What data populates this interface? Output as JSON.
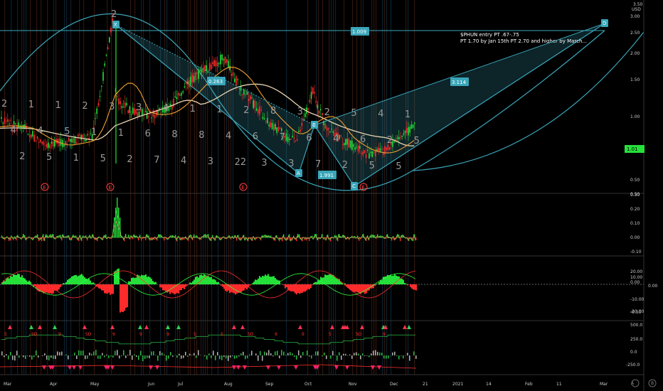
{
  "chart": {
    "currency": "USD",
    "annotation_lines": [
      "$PHUN entry PT .67-.75",
      "PT 1.70 by Jan 15th PT 2.70 and higher by March..."
    ],
    "last_price_label": "1.01",
    "colors": {
      "up": "#26e03a",
      "down": "#ff2b2b",
      "pattern": "#3aa6b9",
      "ma_tan": "#e8d4b0",
      "ma_orange": "#f0a030"
    }
  },
  "chart_data": [
    {
      "type": "candlestick",
      "panel": "price",
      "xlabels": [
        "Mar",
        "Apr",
        "May",
        "Jun",
        "Jul",
        "Aug",
        "Sep",
        "Oct",
        "Nov",
        "Dec",
        "21",
        "2021",
        "14",
        "Feb",
        "11",
        "Mar"
      ],
      "yticks": [
        0.5,
        1.0,
        1.5,
        2.0,
        2.5,
        3.0
      ],
      "ytick_labels": [
        "0.50",
        "1.00",
        "1.50",
        "2.00",
        "2.50",
        "3.00"
      ],
      "ylim": [
        0.5,
        3.5
      ],
      "top_label": "3.50",
      "bottom_label": "0.50",
      "price_path": [
        [
          "Mar",
          0.95
        ],
        [
          "Apr",
          0.85
        ],
        [
          "Apr",
          0.72
        ],
        [
          "May",
          0.75
        ],
        [
          "May",
          0.8
        ],
        [
          "May",
          3.0
        ],
        [
          "May",
          1.2
        ],
        [
          "Jun",
          1.05
        ],
        [
          "Jun",
          1.0
        ],
        [
          "Jul",
          1.1
        ],
        [
          "Jul",
          1.5
        ],
        [
          "Aug",
          1.9
        ],
        [
          "Aug",
          1.4
        ],
        [
          "Sep",
          1.1
        ],
        [
          "Sep",
          0.88
        ],
        [
          "Oct",
          0.75
        ],
        [
          "Oct",
          1.3
        ],
        [
          "Oct",
          0.85
        ],
        [
          "Nov",
          0.72
        ],
        [
          "Nov",
          0.65
        ],
        [
          "Dec",
          0.7
        ],
        [
          "Dec",
          0.9
        ]
      ],
      "xabcd": {
        "points": [
          {
            "label": "X",
            "date": "May",
            "value": 3.0
          },
          {
            "label": "A",
            "date": "Oct",
            "value": 0.65
          },
          {
            "label": "B",
            "date": "Oct",
            "value": 1.32
          },
          {
            "label": "C",
            "date": "Nov",
            "value": 0.5
          },
          {
            "label": "D",
            "date": "Mar",
            "value": 3.0
          }
        ],
        "ratios": [
          "1.009",
          "0.263",
          "1.991",
          "3.114"
        ]
      },
      "wave_counts": [
        "2",
        "4",
        "2",
        "1",
        "4",
        "5",
        "1",
        "5",
        "1",
        "2",
        "1",
        "5",
        "3",
        "1",
        "2",
        "3",
        "6",
        "7",
        "4",
        "8",
        "4",
        "1",
        "8",
        "3",
        "1",
        "4",
        "22",
        "2",
        "6",
        "3",
        "8",
        "7",
        "3",
        "3",
        "6",
        "7",
        "2",
        "4",
        "2",
        "5",
        "6",
        "5",
        "4",
        "2",
        "5",
        "1",
        "5"
      ],
      "circle_labels": [
        "E",
        "E",
        "E",
        "E"
      ]
    },
    {
      "type": "bar",
      "panel": "oscillator-1",
      "yticks": [
        0.3,
        0.2,
        0.1,
        0.0,
        -0.1
      ],
      "ytick_labels": [
        "0.30",
        "0.20",
        "0.10",
        "0.00",
        "-0.10"
      ],
      "ylim": [
        -0.1,
        0.3
      ],
      "spike_value": 0.28
    },
    {
      "type": "area",
      "panel": "oscillator-2",
      "yticks": [
        20,
        0,
        -20
      ],
      "ytick_labels": [
        "20.00",
        "10.00",
        "0.00",
        "0.00",
        "-10.00",
        "-20.00"
      ],
      "ylim": [
        -0.5,
        0.5
      ],
      "label": "-0.50"
    },
    {
      "type": "line",
      "panel": "signals",
      "ytick_labels": [
        "500.0",
        "250.0",
        "0.0",
        "-250.0"
      ],
      "signal_labels": [
        "5",
        "SD",
        "9",
        "SD",
        "9",
        "9",
        "9",
        "S",
        "S",
        "SD",
        "9",
        "9",
        "5",
        "SD",
        "9"
      ]
    }
  ]
}
